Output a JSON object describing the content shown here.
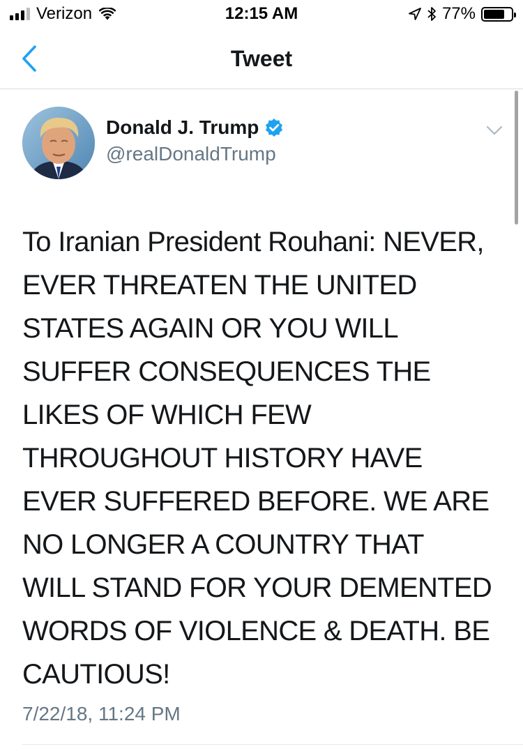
{
  "status_bar": {
    "carrier": "Verizon",
    "time": "12:15 AM",
    "battery_percent": "77%",
    "battery_level": 0.77,
    "signal_bars_filled": 3,
    "signal_bars_total": 4,
    "icons": [
      "signal-icon",
      "wifi-icon",
      "location-arrow-icon",
      "bluetooth-icon",
      "battery-icon"
    ]
  },
  "nav": {
    "title": "Tweet",
    "back_icon": "chevron-left-icon",
    "accent_color": "#1da1f2"
  },
  "tweet": {
    "author": {
      "display_name": "Donald J. Trump",
      "handle": "@realDonaldTrump",
      "verified": true,
      "verified_color": "#1da1f2"
    },
    "text": "To Iranian President Rouhani: NEVER,\nEVER THREATEN THE UNITED\nSTATES AGAIN OR YOU WILL\nSUFFER CONSEQUENCES THE\nLIKES OF WHICH FEW\nTHROUGHOUT HISTORY HAVE\nEVER SUFFERED BEFORE. WE ARE\nNO LONGER A COUNTRY THAT\nWILL STAND FOR YOUR DEMENTED\nWORDS OF VIOLENCE & DEATH. BE\nCAUTIOUS!",
    "timestamp": "7/22/18, 11:24 PM",
    "menu_icon": "chevron-down-icon"
  },
  "colors": {
    "text_primary": "#14171a",
    "text_secondary": "#657786",
    "divider": "#e1e8ed"
  }
}
